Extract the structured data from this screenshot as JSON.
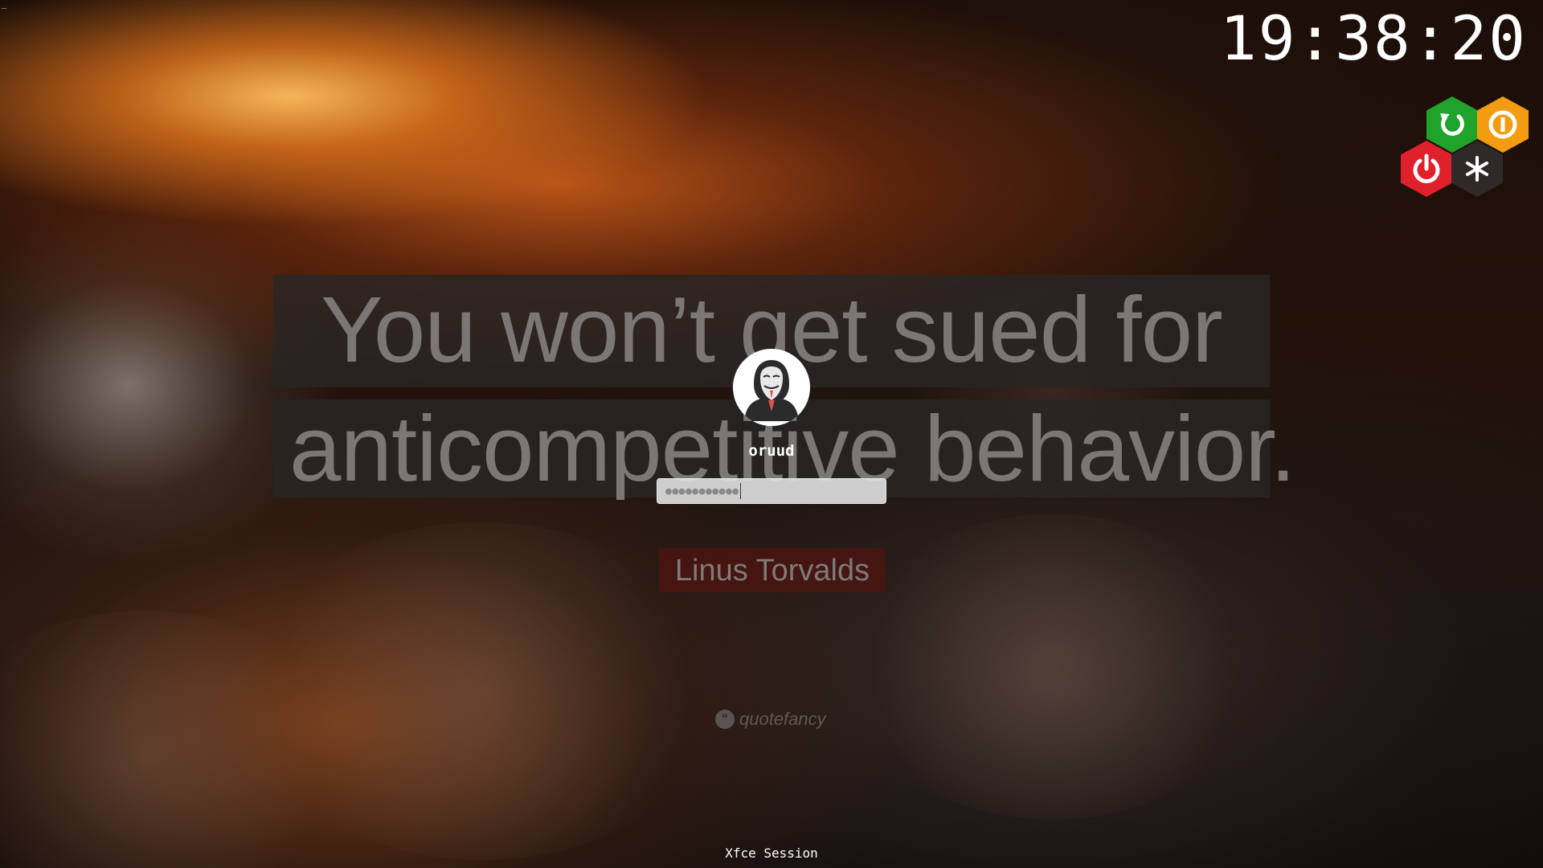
{
  "top_marker": "_",
  "clock": {
    "time": "19:38:20"
  },
  "power": {
    "restart": {
      "icon": "restart-icon",
      "color": "#1fa32a"
    },
    "suspend": {
      "icon": "suspend-icon",
      "color": "#f39c12"
    },
    "shutdown": {
      "icon": "power-icon",
      "color": "#e0202a"
    },
    "other": {
      "icon": "asterisk-icon",
      "color": "#2f2a29"
    }
  },
  "wallpaper": {
    "quote_line1": "You won’t get sued for",
    "quote_line2": "anticompetitive behavior.",
    "author": "Linus Torvalds",
    "watermark": "quotefancy"
  },
  "login": {
    "username": "oruud",
    "password_mask": "●●●●●●●●●●●",
    "avatar_icon": "anonymous-mask-icon"
  },
  "session": {
    "label": "Xfce Session"
  }
}
